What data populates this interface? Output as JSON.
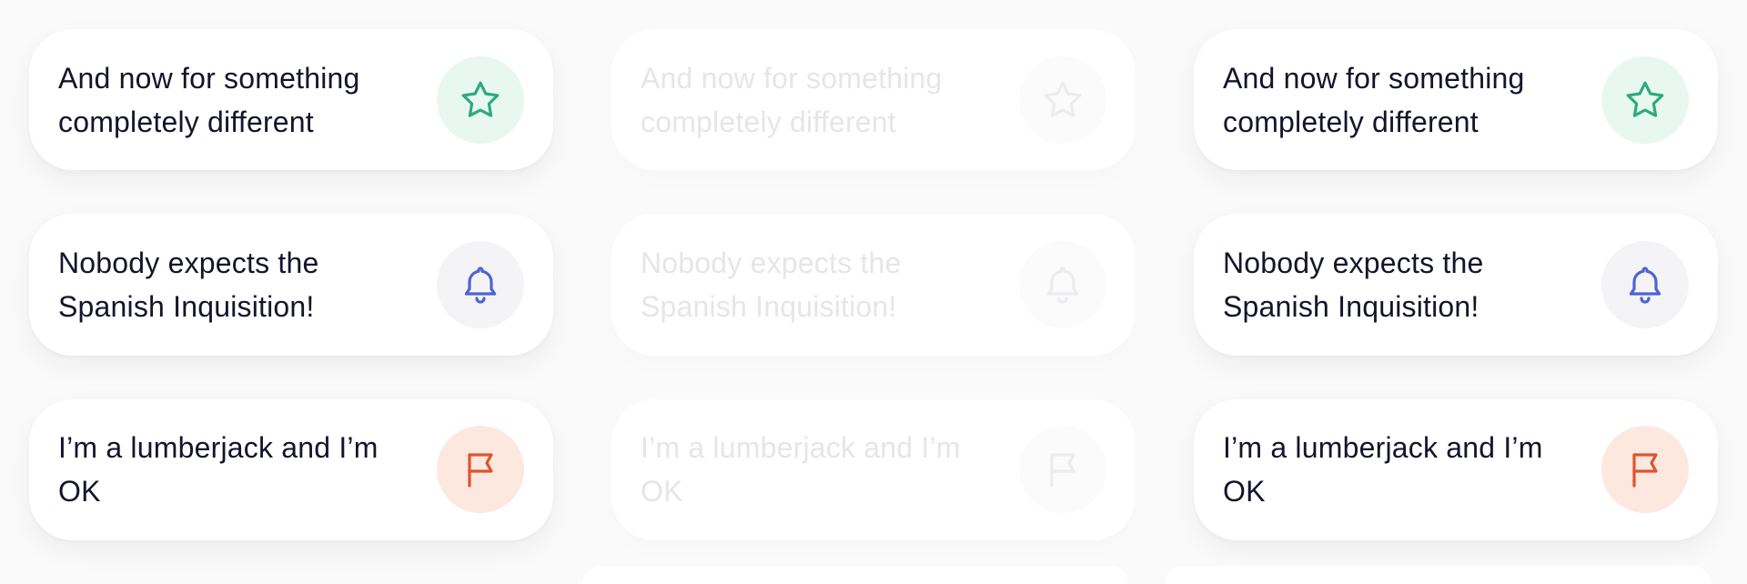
{
  "columns": [
    {
      "state": "normal",
      "cards": [
        {
          "text": "And now for something completely different",
          "icon": "star-icon",
          "tone": "green"
        },
        {
          "text": "Nobody expects the Spanish Inquisition!",
          "icon": "bell-icon",
          "tone": "gray"
        },
        {
          "text": "I’m a lumberjack and I’m OK",
          "icon": "flag-icon",
          "tone": "orange"
        }
      ]
    },
    {
      "state": "disabled",
      "cards": [
        {
          "text": "And now for something completely different",
          "icon": "star-icon",
          "tone": "faded"
        },
        {
          "text": "Nobody expects the Spanish Inquisition!",
          "icon": "bell-icon",
          "tone": "faded"
        },
        {
          "text": "I’m a lumberjack and I’m OK",
          "icon": "flag-icon",
          "tone": "faded"
        }
      ]
    },
    {
      "state": "normal",
      "cards": [
        {
          "text": "And now for something completely different",
          "icon": "star-icon",
          "tone": "green"
        },
        {
          "text": "Nobody expects the Spanish Inquisition!",
          "icon": "bell-icon",
          "tone": "gray"
        },
        {
          "text": "I’m a lumberjack and I’m OK",
          "icon": "flag-icon",
          "tone": "orange"
        }
      ]
    }
  ],
  "colors": {
    "text": "#14142b",
    "green_icon": "#2daa7f",
    "green_bg": "#e8f8f1",
    "blue_icon": "#4f63d2",
    "gray_bg": "#f4f4f6",
    "orange_icon": "#e0542c",
    "orange_bg": "#fde8e0"
  }
}
